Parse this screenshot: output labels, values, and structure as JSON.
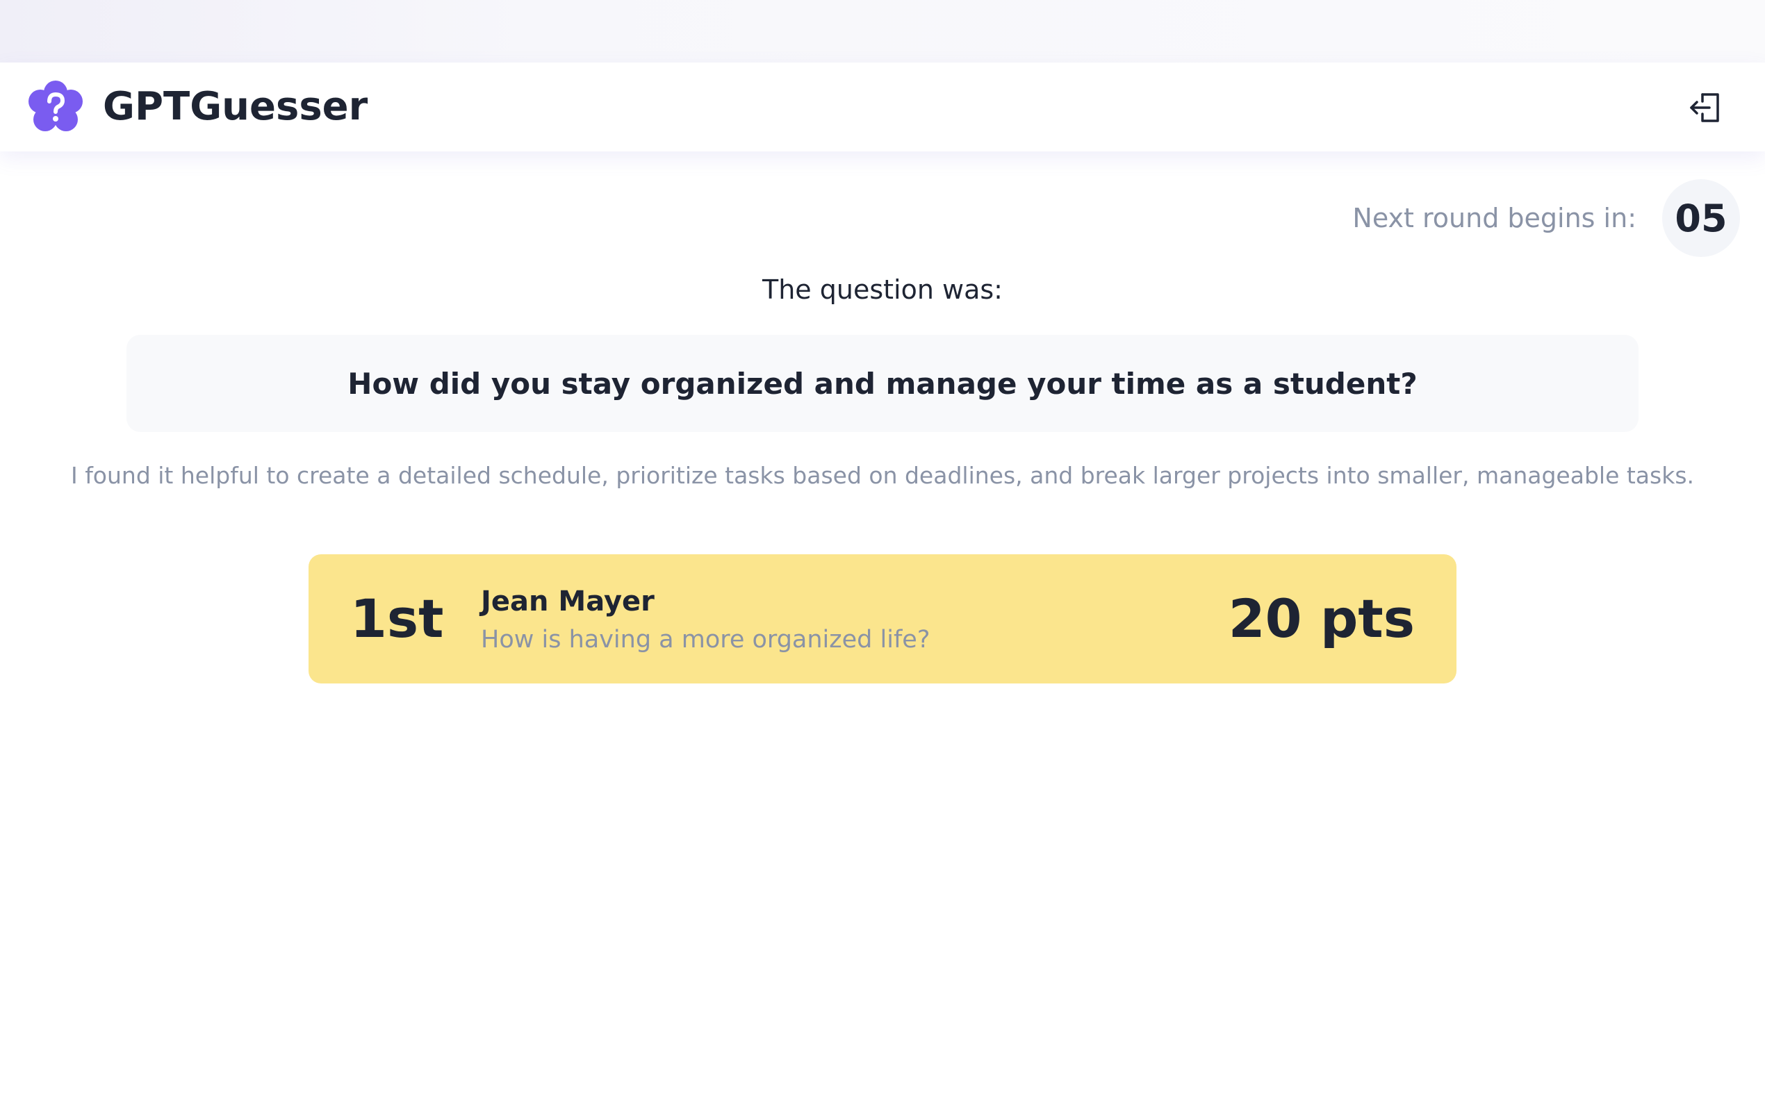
{
  "app": {
    "brand_name": "GPTGuesser",
    "logo_icon": "question-flower-icon",
    "accent_color": "#7a5cf0"
  },
  "header": {
    "logout_icon": "logout-icon"
  },
  "countdown": {
    "label": "Next round begins in:",
    "value": "05"
  },
  "question": {
    "intro": "The question was:",
    "text": "How did you stay organized and manage your time as a student?",
    "answer": "I found it helpful to create a detailed schedule, prioritize tasks based on deadlines, and break larger projects into smaller, manageable tasks."
  },
  "results": [
    {
      "rank": "1st",
      "player": "Jean Mayer",
      "guess": "How is having a more organized life?",
      "points": "20 pts",
      "card_color": "#fbe58d"
    }
  ]
}
